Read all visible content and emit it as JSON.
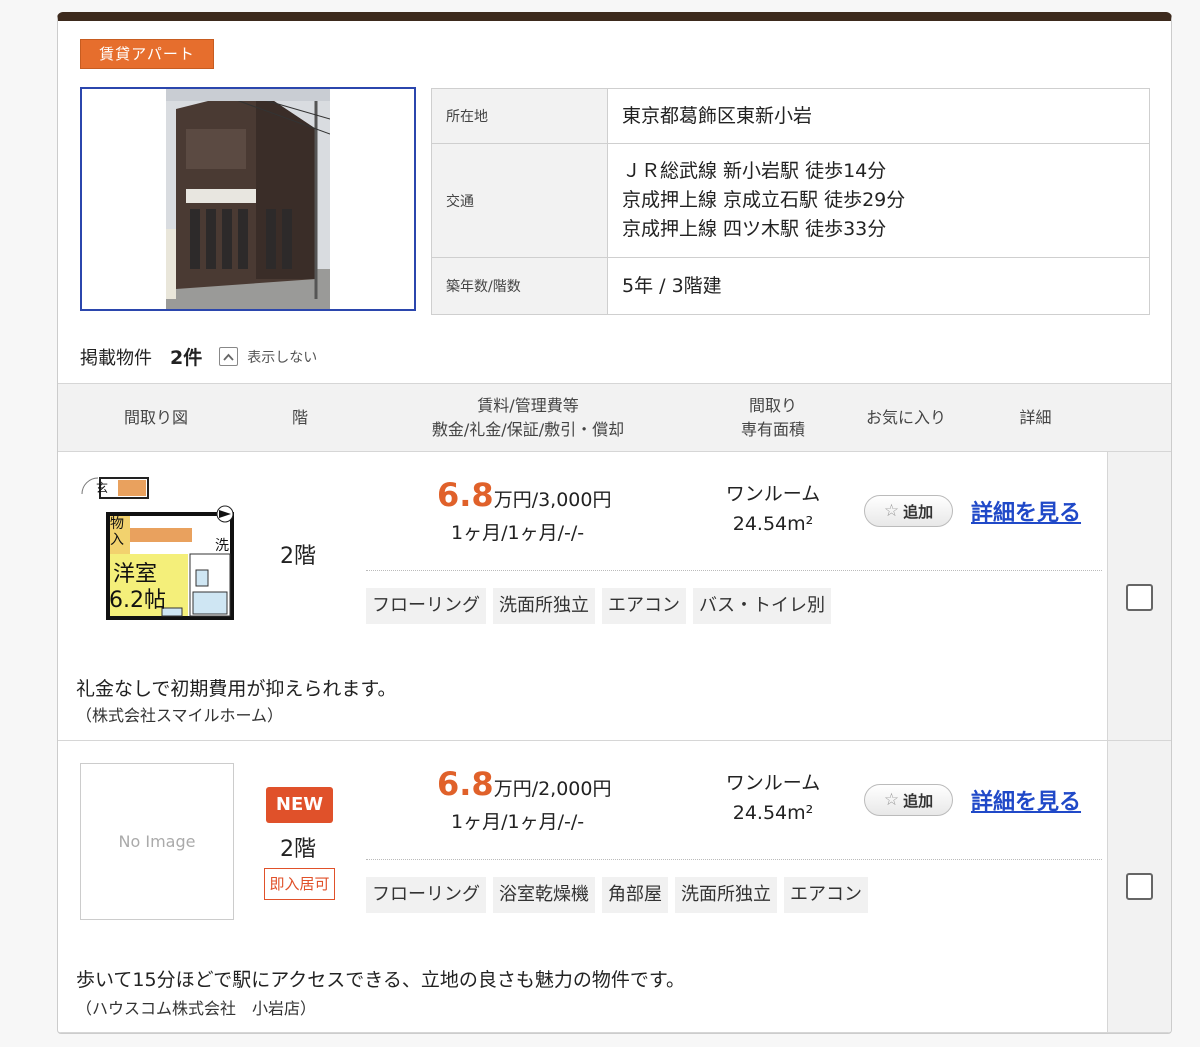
{
  "property": {
    "type_badge": "賃貸アパート",
    "address_label": "所在地",
    "address": "東京都葛飾区東新小岩",
    "transit_label": "交通",
    "transit": [
      "ＪＲ総武線 新小岩駅 徒歩14分",
      "京成押上線 京成立石駅 徒歩29分",
      "京成押上線 四ツ木駅 徒歩33分"
    ],
    "age_label": "築年数/階数",
    "age": "5年 / 3階建"
  },
  "listed": {
    "label": "掲載物件",
    "count": "2件",
    "toggle_label": "表示しない"
  },
  "table_header": {
    "floorplan": "間取り図",
    "floor": "階",
    "rent_line1": "賃料/管理費等",
    "rent_line2": "敷金/礼金/保証/敷引・償却",
    "layout_line1": "間取り",
    "layout_line2": "専有面積",
    "favorite": "お気に入り",
    "detail": "詳細"
  },
  "listings": [
    {
      "floor": "2階",
      "rent_big": "6.8",
      "rent_rest": "万円/3,000円",
      "deposit": "1ヶ月/1ヶ月/-/-",
      "layout": "ワンルーム",
      "area": "24.54m²",
      "fav_label": "追加",
      "detail_label": "詳細を見る",
      "tags": [
        "フローリング",
        "洗面所独立",
        "エアコン",
        "バス・トイレ別"
      ],
      "comment": "礼金なしで初期費用が抑えられます。",
      "company": "（株式会社スマイルホーム）",
      "plan_room": "洋室",
      "plan_size": "6.2帖",
      "plan_entry": "玄",
      "plan_storage": "物入",
      "plan_wash": "洗"
    },
    {
      "floor": "2階",
      "new_badge": "NEW",
      "movein": "即入居可",
      "noimage": "No Image",
      "rent_big": "6.8",
      "rent_rest": "万円/2,000円",
      "deposit": "1ヶ月/1ヶ月/-/-",
      "layout": "ワンルーム",
      "area": "24.54m²",
      "fav_label": "追加",
      "detail_label": "詳細を見る",
      "tags": [
        "フローリング",
        "浴室乾燥機",
        "角部屋",
        "洗面所独立",
        "エアコン"
      ],
      "comment": "歩いて15分ほどで駅にアクセスできる、立地の良さも魅力の物件です。",
      "company": "（ハウスコム株式会社　小岩店）"
    }
  ],
  "colors": {
    "accent": "#e66e2d",
    "price": "#e0612a",
    "link": "#2049c8",
    "topbar": "#3d2a1d"
  }
}
